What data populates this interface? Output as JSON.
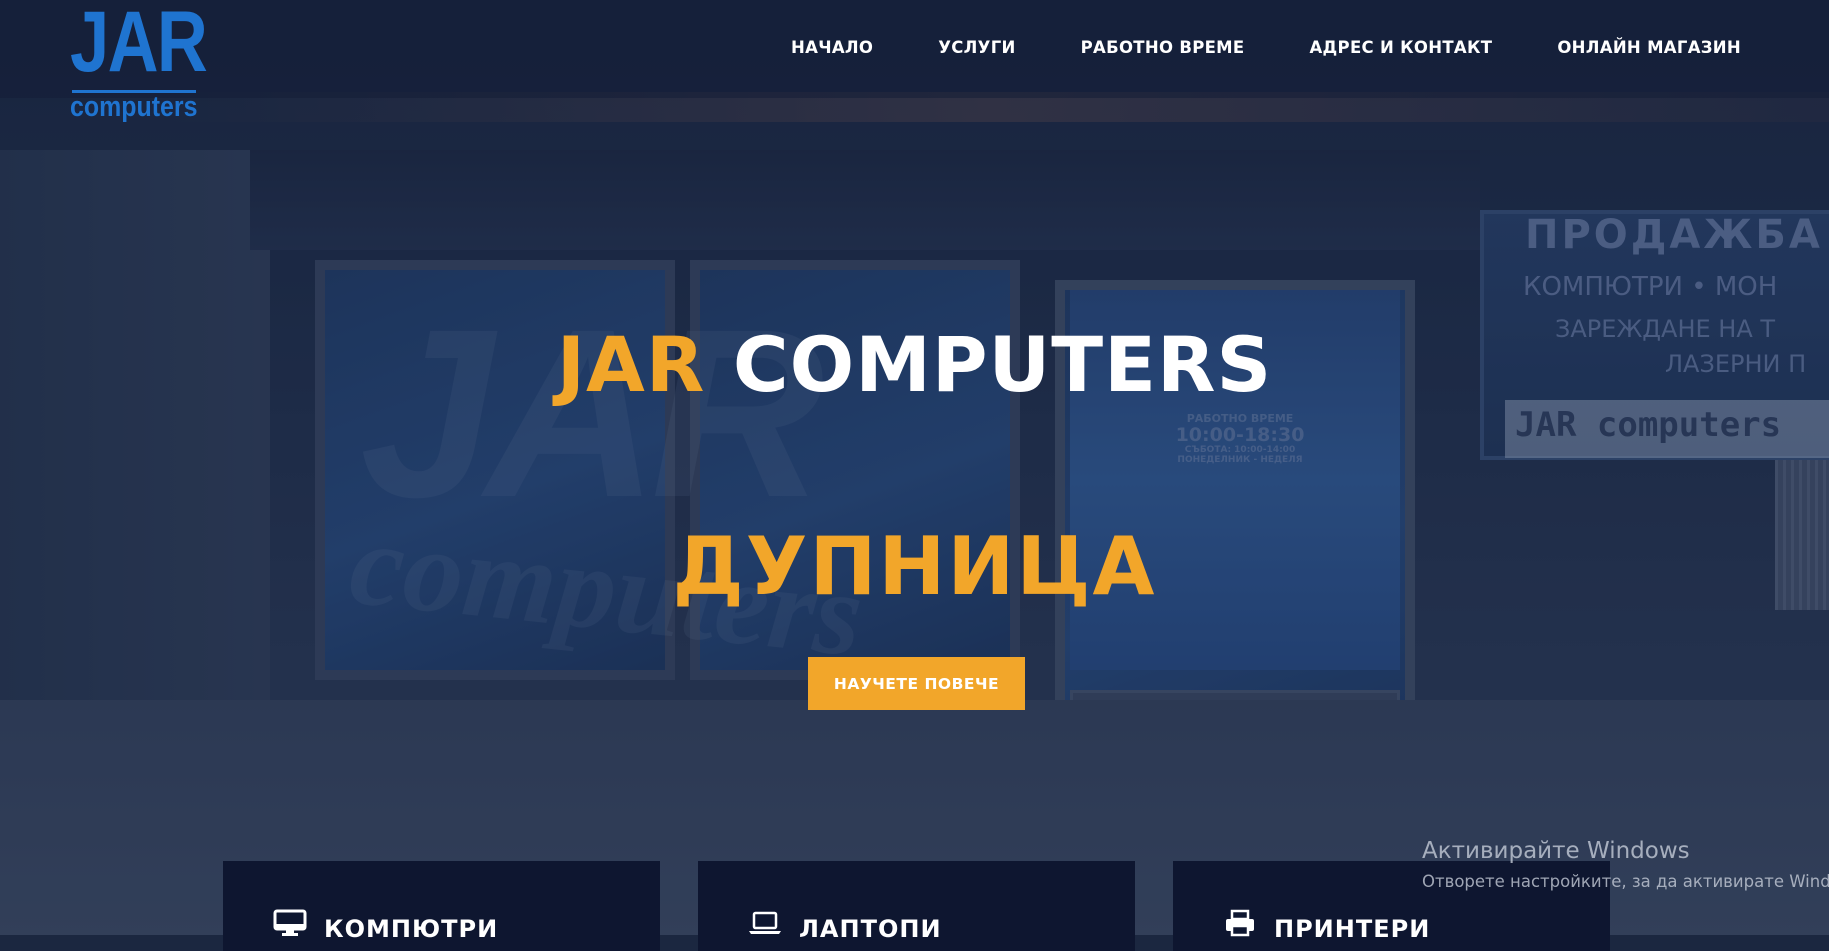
{
  "header": {
    "logo": {
      "main": "JAR",
      "sub": "computers"
    },
    "nav": [
      {
        "label": "НАЧАЛО"
      },
      {
        "label": "УСЛУГИ"
      },
      {
        "label": "РАБОТНО ВРЕМЕ"
      },
      {
        "label": "АДРЕС И КОНТАКТ"
      },
      {
        "label": "ОНЛАЙН МАГАЗИН"
      }
    ]
  },
  "hero": {
    "title_accent": "JAR",
    "title_main": "COMPUTERS",
    "city": "ДУПНИЦА",
    "cta_label": "НАУЧЕТЕ ПОВЕЧЕ"
  },
  "background_photo": {
    "sign_line_1": "ПРОДАЖБА",
    "sign_line_2": "КОМПЮТРИ • МОН",
    "sign_line_3": "ЗАРЕЖДАНЕ НА Т",
    "sign_line_4": "ЛАЗЕРНИ П",
    "sign_plate": "JAR computers",
    "door_hours_title": "РАБОТНО ВРЕМЕ",
    "door_hours_time": "10:00-18:30",
    "door_hours_saturday": "СЪБОТА: 10:00-14:00",
    "door_hours_closed": "ПОНЕДЕЛНИК - НЕДЕЛЯ"
  },
  "services": [
    {
      "label": "КОМПЮТРИ",
      "icon": "monitor-icon"
    },
    {
      "label": "ЛАПТОПИ",
      "icon": "laptop-icon"
    },
    {
      "label": "ПРИНТЕРИ",
      "icon": "printer-icon"
    }
  ],
  "os_watermark": {
    "line1": "Активирайте Windows",
    "line2": "Отворете настройките, за да активирате Windows."
  },
  "colors": {
    "accent": "#f2a62a",
    "logo_blue": "#1f74d0",
    "card_bg": "#0e1630",
    "header_bg": "#141e36"
  }
}
